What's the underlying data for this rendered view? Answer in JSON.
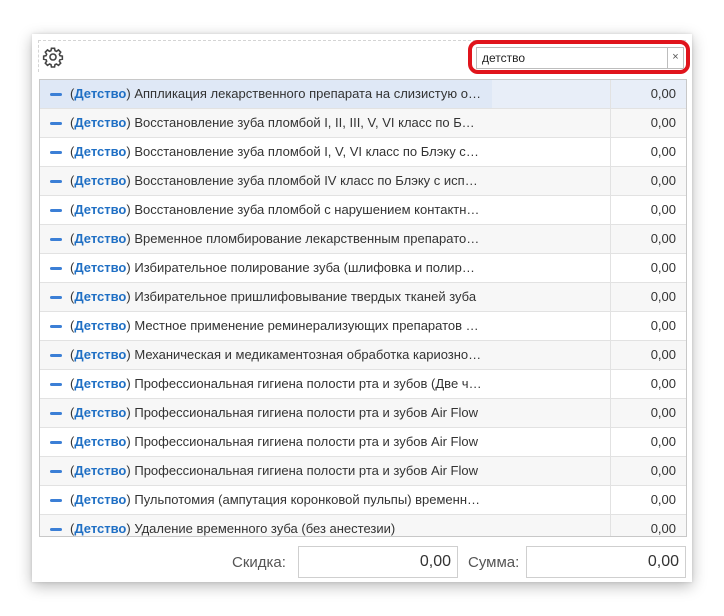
{
  "search": {
    "value": "детство",
    "clear_label": "×"
  },
  "icons": {
    "settings": "gear-icon",
    "row_expand": "minus-icon"
  },
  "colors": {
    "highlight_border": "#e0141c",
    "category_text": "#1f6fc4",
    "selected_row": "#e8eef8"
  },
  "rows": [
    {
      "category": "Детство",
      "name": "Аппликация лекарственного препарата на слизистую оболочку",
      "value": "0,00"
    },
    {
      "category": "Детство",
      "name": "Восстановление зуба пломбой I, II, III, V, VI класс по Блэку",
      "value": "0,00"
    },
    {
      "category": "Детство",
      "name": "Восстановление зуба пломбой I, V, VI класс по Блэку с использованием",
      "value": "0,00"
    },
    {
      "category": "Детство",
      "name": "Восстановление зуба пломбой IV класс по Блэку с использованием",
      "value": "0,00"
    },
    {
      "category": "Детство",
      "name": "Восстановление зуба пломбой с нарушением контактного пункта",
      "value": "0,00"
    },
    {
      "category": "Детство",
      "name": "Временное пломбирование лекарственным препаратом зуба",
      "value": "0,00"
    },
    {
      "category": "Детство",
      "name": "Избирательное полирование зуба (шлифовка и полировка)",
      "value": "0,00"
    },
    {
      "category": "Детство",
      "name": "Избирательное пришлифовывание твердых тканей зуба",
      "value": "0,00"
    },
    {
      "category": "Детство",
      "name": "Местное применение реминерализующих препаратов в области зуба",
      "value": "0,00"
    },
    {
      "category": "Детство",
      "name": "Механическая и медикаментозная обработка кариозной полости",
      "value": "0,00"
    },
    {
      "category": "Детство",
      "name": "Профессиональная гигиена полости рта и зубов (Две челюсти)",
      "value": "0,00"
    },
    {
      "category": "Детство",
      "name": "Профессиональная гигиена полости рта и зубов Air Flow",
      "value": "0,00"
    },
    {
      "category": "Детство",
      "name": "Профессиональная гигиена полости рта и зубов Air Flow",
      "value": "0,00"
    },
    {
      "category": "Детство",
      "name": "Профессиональная гигиена полости рта и зубов Air Flow",
      "value": "0,00"
    },
    {
      "category": "Детство",
      "name": "Пульпотомия (ампутация коронковой пульпы) временного зуба",
      "value": "0,00"
    },
    {
      "category": "Детство",
      "name": "Удаление временного зуба (без анестезии)",
      "value": "0,00"
    }
  ],
  "footer": {
    "discount_label": "Скидка:",
    "discount_value": "0,00",
    "sum_label": "Сумма:",
    "sum_value": "0,00"
  }
}
